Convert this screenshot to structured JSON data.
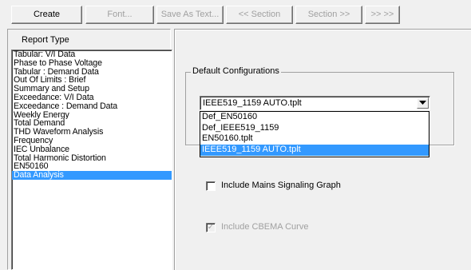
{
  "toolbar": {
    "create_label": "Create",
    "font_label": "Font...",
    "save_as_text_label": "Save As Text...",
    "prev_section_label": "<< Section",
    "next_section_label": "Section >>",
    "last_label": ">> >>"
  },
  "left_panel": {
    "title": "Report Type",
    "items": [
      {
        "label": "Tabular: V/I Data"
      },
      {
        "label": "Phase to Phase Voltage"
      },
      {
        "label": "Tabular : Demand Data"
      },
      {
        "label": "Out Of Limits : Brief"
      },
      {
        "label": "Summary and Setup"
      },
      {
        "label": "Exceedance: V/I Data"
      },
      {
        "label": "Exceedance : Demand Data"
      },
      {
        "label": "Weekly Energy"
      },
      {
        "label": "Total Demand"
      },
      {
        "label": "THD Waveform Analysis"
      },
      {
        "label": "Frequency"
      },
      {
        "label": "IEC Unbalance"
      },
      {
        "label": "Total Harmonic Distortion"
      },
      {
        "label": "EN50160"
      },
      {
        "label": "Data Analysis"
      }
    ],
    "selected_item": "Data Analysis"
  },
  "default_config": {
    "group_label": "Default Configurations",
    "selected_value": "IEEE519_1159 AUTO.tplt",
    "dropdown_arrow": "chevron-down-icon",
    "options": [
      {
        "label": "Def_EN50160"
      },
      {
        "label": "Def_IEEE519_1159"
      },
      {
        "label": "EN50160.tplt"
      },
      {
        "label": "IEEE519_1159 AUTO.tplt"
      }
    ]
  },
  "options": {
    "mains_signaling_label": "Include Mains Signaling Graph",
    "mains_signaling_checked": false,
    "cbema_label": "Include CBEMA Curve",
    "cbema_checked": true,
    "cbema_enabled": false,
    "check_glyph": "✓"
  },
  "colors": {
    "selection": "#3399ff",
    "window_bg": "#f0f0f0",
    "disabled_text": "#a0a0a0"
  }
}
